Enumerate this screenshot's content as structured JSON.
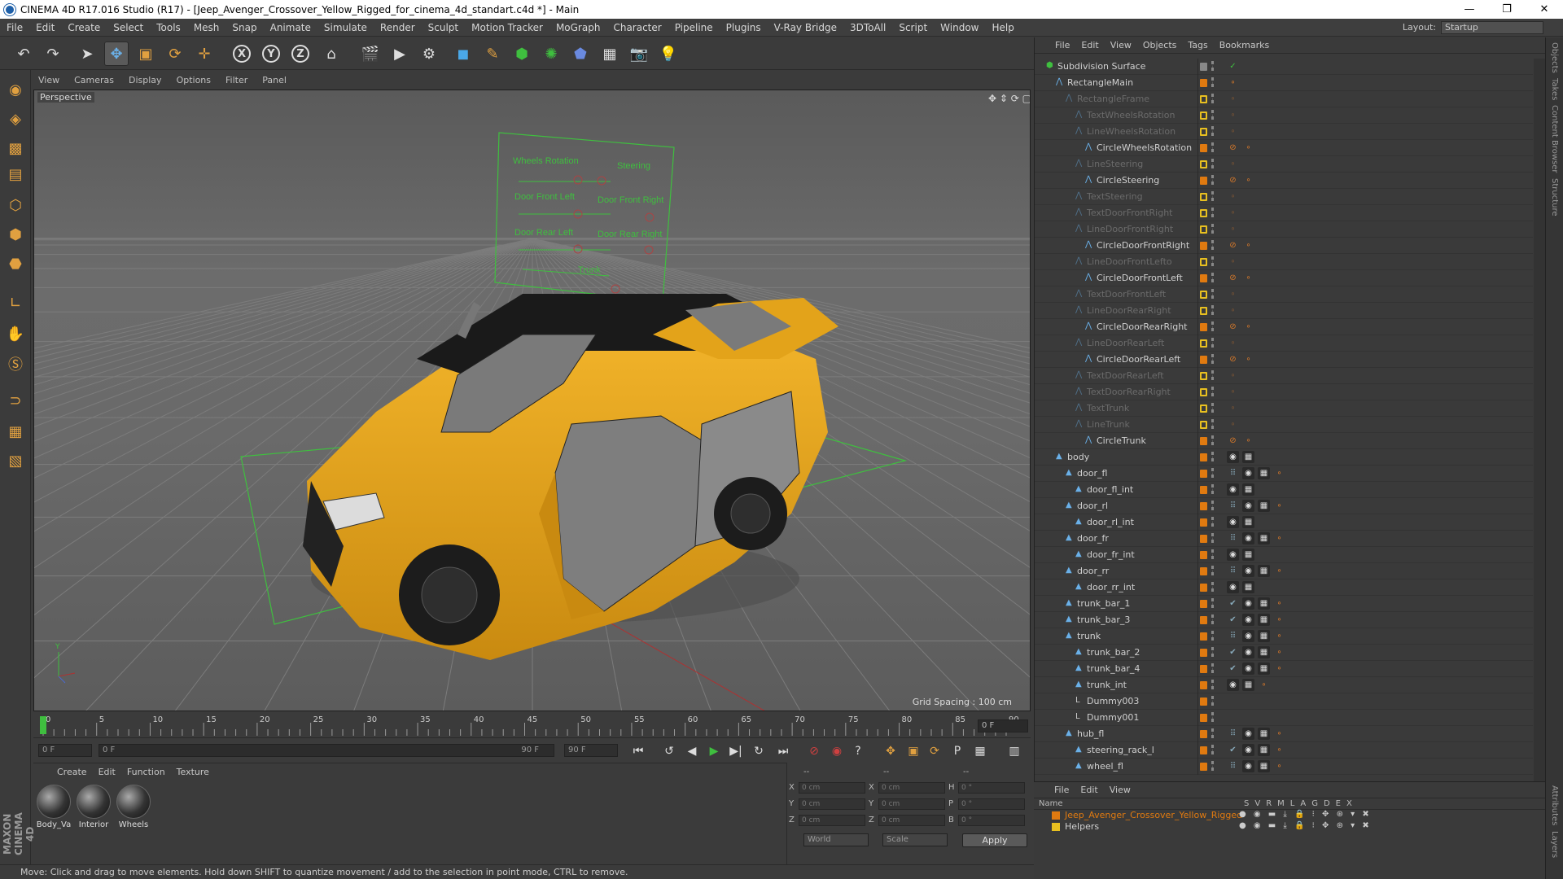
{
  "window": {
    "title": "CINEMA 4D R17.016 Studio (R17) - [Jeep_Avenger_Crossover_Yellow_Rigged_for_cinema_4d_standart.c4d *] - Main",
    "controls": [
      "—",
      "❐",
      "✕"
    ]
  },
  "menubar": {
    "items": [
      "File",
      "Edit",
      "Create",
      "Select",
      "Tools",
      "Mesh",
      "Snap",
      "Animate",
      "Simulate",
      "Render",
      "Sculpt",
      "Motion Tracker",
      "MoGraph",
      "Character",
      "Pipeline",
      "Plugins",
      "V-Ray Bridge",
      "3DToAll",
      "Script",
      "Window",
      "Help"
    ],
    "layout_label": "Layout:",
    "layout_value": "Startup"
  },
  "toolbar": {
    "icons": [
      "undo-icon",
      "redo-icon",
      "live-select-icon",
      "move-icon",
      "scale-icon",
      "rotate-icon",
      "move-last-icon",
      "x-axis-icon",
      "y-axis-icon",
      "z-axis-icon",
      "coordinate-system-icon",
      "render-view-icon",
      "render-picture-viewer-icon",
      "render-settings-icon",
      "cube-icon",
      "pen-icon",
      "subdivision-icon",
      "array-icon",
      "deformer-icon",
      "floor-icon",
      "camera-icon",
      "light-icon"
    ],
    "axis_labels": [
      "X",
      "Y",
      "Z"
    ]
  },
  "viewport": {
    "menu": [
      "View",
      "Cameras",
      "Display",
      "Options",
      "Filter",
      "Panel"
    ],
    "name": "Perspective",
    "grid_spacing": "Grid Spacing : 100 cm",
    "rig_labels": [
      "Wheels Rotation",
      "Steering",
      "Door Front Left",
      "Door Front Right",
      "Door Rear Left",
      "Door Rear Right",
      "Trunk"
    ]
  },
  "timeline": {
    "ticks": [
      "0",
      "5",
      "10",
      "15",
      "20",
      "25",
      "30",
      "35",
      "40",
      "45",
      "50",
      "55",
      "60",
      "65",
      "70",
      "75",
      "80",
      "85",
      "90"
    ],
    "current_frame": "0 F",
    "start_field": "0 F",
    "range_start": "0 F",
    "range_end": "90 F",
    "end_field": "90 F"
  },
  "materials": {
    "menu": [
      "Create",
      "Edit",
      "Function",
      "Texture"
    ],
    "items": [
      "Body_Va",
      "Interior",
      "Wheels"
    ]
  },
  "coordinates": {
    "header": [
      "--",
      "--",
      "--"
    ],
    "rows": [
      {
        "a": "X",
        "av": "0 cm",
        "b": "X",
        "bv": "0 cm",
        "c": "H",
        "cv": "0 °"
      },
      {
        "a": "Y",
        "av": "0 cm",
        "b": "Y",
        "bv": "0 cm",
        "c": "P",
        "cv": "0 °"
      },
      {
        "a": "Z",
        "av": "0 cm",
        "b": "Z",
        "bv": "0 cm",
        "c": "B",
        "cv": "0 °"
      }
    ],
    "space": "World",
    "mode": "Scale",
    "apply": "Apply"
  },
  "status": "Move: Click and drag to move elements. Hold down SHIFT to quantize movement / add to the selection in point mode, CTRL to remove.",
  "logo": "MAXON CINEMA 4D",
  "objects": {
    "menu": [
      "File",
      "Edit",
      "View",
      "Objects",
      "Tags",
      "Bookmarks"
    ],
    "rows": [
      {
        "name": "Subdivision Surface",
        "level": 0,
        "dim": false,
        "icon": "subdivision",
        "tags": [
          "checkmark"
        ]
      },
      {
        "name": "RectangleMain",
        "level": 1,
        "dim": false,
        "icon": "spline",
        "tags": [
          "null"
        ]
      },
      {
        "name": "RectangleFrame",
        "level": 2,
        "dim": true,
        "icon": "spline",
        "tags": [
          "null"
        ]
      },
      {
        "name": "TextWheelsRotation",
        "level": 3,
        "dim": true,
        "icon": "spline",
        "tags": [
          "null"
        ]
      },
      {
        "name": "LineWheelsRotation",
        "level": 3,
        "dim": true,
        "icon": "spline",
        "tags": [
          "null"
        ]
      },
      {
        "name": "CircleWheelsRotation",
        "level": 4,
        "dim": false,
        "icon": "spline",
        "tags": [
          "xpresso",
          "null"
        ]
      },
      {
        "name": "LineSteering",
        "level": 3,
        "dim": true,
        "icon": "spline",
        "tags": [
          "null"
        ]
      },
      {
        "name": "CircleSteering",
        "level": 4,
        "dim": false,
        "icon": "spline",
        "tags": [
          "xpresso",
          "null"
        ]
      },
      {
        "name": "TextSteering",
        "level": 3,
        "dim": true,
        "icon": "spline",
        "tags": [
          "null"
        ]
      },
      {
        "name": "TextDoorFrontRight",
        "level": 3,
        "dim": true,
        "icon": "spline",
        "tags": [
          "null"
        ]
      },
      {
        "name": "LineDoorFrontRight",
        "level": 3,
        "dim": true,
        "icon": "spline",
        "tags": [
          "null"
        ]
      },
      {
        "name": "CircleDoorFrontRight",
        "level": 4,
        "dim": false,
        "icon": "spline",
        "tags": [
          "xpresso",
          "null"
        ]
      },
      {
        "name": "LineDoorFrontLefto",
        "level": 3,
        "dim": true,
        "icon": "spline",
        "tags": [
          "null"
        ]
      },
      {
        "name": "CircleDoorFrontLeft",
        "level": 4,
        "dim": false,
        "icon": "spline",
        "tags": [
          "xpresso",
          "null"
        ]
      },
      {
        "name": "TextDoorFrontLeft",
        "level": 3,
        "dim": true,
        "icon": "spline",
        "tags": [
          "null"
        ]
      },
      {
        "name": "LineDoorRearRight",
        "level": 3,
        "dim": true,
        "icon": "spline",
        "tags": [
          "null"
        ]
      },
      {
        "name": "CircleDoorRearRight",
        "level": 4,
        "dim": false,
        "icon": "spline",
        "tags": [
          "xpresso",
          "null"
        ]
      },
      {
        "name": "LineDoorRearLeft",
        "level": 3,
        "dim": true,
        "icon": "spline",
        "tags": [
          "null"
        ]
      },
      {
        "name": "CircleDoorRearLeft",
        "level": 4,
        "dim": false,
        "icon": "spline",
        "tags": [
          "xpresso",
          "null"
        ]
      },
      {
        "name": "TextDoorRearLeft",
        "level": 3,
        "dim": true,
        "icon": "spline",
        "tags": [
          "null"
        ]
      },
      {
        "name": "TextDoorRearRight",
        "level": 3,
        "dim": true,
        "icon": "spline",
        "tags": [
          "null"
        ]
      },
      {
        "name": "TextTrunk",
        "level": 3,
        "dim": true,
        "icon": "spline",
        "tags": [
          "null"
        ]
      },
      {
        "name": "LineTrunk",
        "level": 3,
        "dim": true,
        "icon": "spline",
        "tags": [
          "null"
        ]
      },
      {
        "name": "CircleTrunk",
        "level": 4,
        "dim": false,
        "icon": "spline",
        "tags": [
          "xpresso",
          "null"
        ]
      },
      {
        "name": "body",
        "level": 1,
        "dim": false,
        "icon": "poly",
        "tags": [
          "material",
          "checker"
        ]
      },
      {
        "name": "door_fl",
        "level": 2,
        "dim": false,
        "icon": "poly",
        "tags": [
          "dots",
          "material",
          "checker",
          "null"
        ]
      },
      {
        "name": "door_fl_int",
        "level": 3,
        "dim": false,
        "icon": "poly",
        "tags": [
          "material",
          "checker"
        ]
      },
      {
        "name": "door_rl",
        "level": 2,
        "dim": false,
        "icon": "poly",
        "tags": [
          "dots",
          "material",
          "checker",
          "null"
        ]
      },
      {
        "name": "door_rl_int",
        "level": 3,
        "dim": false,
        "icon": "poly",
        "tags": [
          "material",
          "checker"
        ]
      },
      {
        "name": "door_fr",
        "level": 2,
        "dim": false,
        "icon": "poly",
        "tags": [
          "dots",
          "material",
          "checker",
          "null"
        ]
      },
      {
        "name": "door_fr_int",
        "level": 3,
        "dim": false,
        "icon": "poly",
        "tags": [
          "material",
          "checker"
        ]
      },
      {
        "name": "door_rr",
        "level": 2,
        "dim": false,
        "icon": "poly",
        "tags": [
          "dots",
          "material",
          "checker",
          "null"
        ]
      },
      {
        "name": "door_rr_int",
        "level": 3,
        "dim": false,
        "icon": "poly",
        "tags": [
          "material",
          "checker"
        ]
      },
      {
        "name": "trunk_bar_1",
        "level": 2,
        "dim": false,
        "icon": "poly",
        "tags": [
          "vertex",
          "material",
          "checker",
          "null"
        ]
      },
      {
        "name": "trunk_bar_3",
        "level": 2,
        "dim": false,
        "icon": "poly",
        "tags": [
          "vertex",
          "material",
          "checker",
          "null"
        ]
      },
      {
        "name": "trunk",
        "level": 2,
        "dim": false,
        "icon": "poly",
        "tags": [
          "dots",
          "material",
          "checker",
          "null"
        ]
      },
      {
        "name": "trunk_bar_2",
        "level": 3,
        "dim": false,
        "icon": "poly",
        "tags": [
          "vertex",
          "material",
          "checker",
          "null"
        ]
      },
      {
        "name": "trunk_bar_4",
        "level": 3,
        "dim": false,
        "icon": "poly",
        "tags": [
          "vertex",
          "material",
          "checker",
          "null"
        ]
      },
      {
        "name": "trunk_int",
        "level": 3,
        "dim": false,
        "icon": "poly",
        "tags": [
          "material",
          "checker",
          "null"
        ]
      },
      {
        "name": "Dummy003",
        "level": 3,
        "dim": false,
        "icon": "null-obj",
        "tags": []
      },
      {
        "name": "Dummy001",
        "level": 3,
        "dim": false,
        "icon": "null-obj",
        "tags": []
      },
      {
        "name": "hub_fl",
        "level": 2,
        "dim": false,
        "icon": "poly",
        "tags": [
          "dots",
          "material",
          "checker",
          "null"
        ]
      },
      {
        "name": "steering_rack_l",
        "level": 3,
        "dim": false,
        "icon": "poly",
        "tags": [
          "vertex",
          "material",
          "checker",
          "null"
        ]
      },
      {
        "name": "wheel_fl",
        "level": 3,
        "dim": false,
        "icon": "poly",
        "tags": [
          "dots",
          "material",
          "checker",
          "null"
        ]
      }
    ]
  },
  "layers": {
    "menu": [
      "File",
      "Edit",
      "View"
    ],
    "header_name": "Name",
    "header_flags": [
      "S",
      "V",
      "R",
      "M",
      "L",
      "A",
      "G",
      "D",
      "E",
      "X"
    ],
    "rows": [
      {
        "name": "Jeep_Avenger_Crossover_Yellow_Rigged",
        "color": "#e07a10"
      },
      {
        "name": "Helpers",
        "color": "#e8c020"
      }
    ]
  },
  "right_tabs": [
    "Objects",
    "Takes",
    "Content Browser",
    "Structure",
    "Attributes",
    "Layers"
  ],
  "colors": {
    "accent": "#e0a040",
    "car_yellow": "#e3a31a",
    "rig_green": "#3fbf3f",
    "layer_orange": "#e07a10",
    "tag_yellow": "#e8c020",
    "tag_orange": "#d97a2a"
  }
}
